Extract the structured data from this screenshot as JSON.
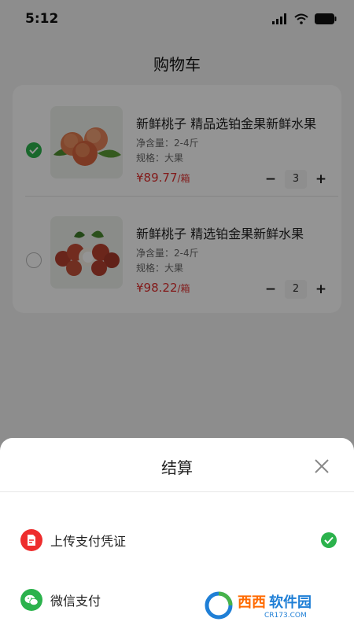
{
  "status_bar": {
    "time": "5:12"
  },
  "page": {
    "title": "购物车"
  },
  "cart": {
    "items": [
      {
        "name": "新鲜桃子 精品选铂金果新鲜水果",
        "net_weight": "净含量：2-4斤",
        "spec": "规格：大果",
        "price": "¥89.77",
        "price_unit": "/箱",
        "quantity": "3",
        "selected": true,
        "image": "peach-image"
      },
      {
        "name": "新鲜桃子 精选铂金果新鲜水果",
        "net_weight": "净含量：2-4斤",
        "spec": "规格：大果",
        "price": "¥98.22",
        "price_unit": "/箱",
        "quantity": "2",
        "selected": false,
        "image": "lychee-image"
      }
    ],
    "minus": "−",
    "plus": "+"
  },
  "checkout_sheet": {
    "title": "结算",
    "methods": [
      {
        "label": "上传支付凭证",
        "icon": "upload-voucher-icon",
        "color": "#ee2d2d",
        "selected": true
      },
      {
        "label": "微信支付",
        "icon": "wechat-icon",
        "color": "#2bb24c",
        "selected": false
      }
    ]
  },
  "watermark": {
    "brand": "西西软件园",
    "site": "CR173.COM"
  },
  "colors": {
    "accent_green": "#2bb24c",
    "price_red": "#e0302f"
  }
}
